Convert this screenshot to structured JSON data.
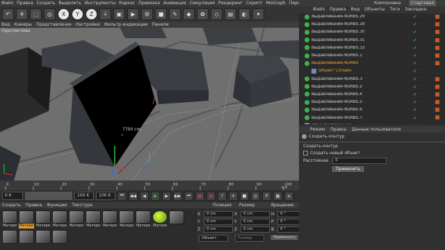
{
  "menubar": [
    "Файл",
    "Правка",
    "Создать",
    "Выделить",
    "Инструменты",
    "Каркас",
    "Привязка",
    "Анимация",
    "Симуляция",
    "Рендеринг",
    "Скрипт",
    "MoGraph",
    "Персонаж",
    "Плагины",
    "Окно",
    "Справка"
  ],
  "toolbar_icons": [
    {
      "name": "undo-icon",
      "glyph": "↶"
    },
    {
      "name": "move-icon",
      "glyph": "✛"
    },
    {
      "name": "select-icon",
      "glyph": "⬚"
    },
    {
      "name": "rotate-icon",
      "glyph": "◎"
    },
    {
      "name": "x-axis-icon",
      "glyph": "X"
    },
    {
      "name": "y-axis-icon",
      "glyph": "Y"
    },
    {
      "name": "z-axis-icon",
      "glyph": "Z"
    },
    {
      "name": "coordinate-icon",
      "glyph": "⤓"
    },
    {
      "name": "render-region-icon",
      "glyph": "▣"
    },
    {
      "name": "render-view-icon",
      "glyph": "▶"
    },
    {
      "name": "render-settings-icon",
      "glyph": "⚙"
    },
    {
      "name": "cube-icon",
      "glyph": "■"
    },
    {
      "name": "pen-icon",
      "glyph": "✎"
    },
    {
      "name": "subdivision-icon",
      "glyph": "◆"
    },
    {
      "name": "array-icon",
      "glyph": "✿"
    },
    {
      "name": "deformer-icon",
      "glyph": "◇"
    },
    {
      "name": "scene-icon",
      "glyph": "▤"
    },
    {
      "name": "camera-icon",
      "glyph": "◐"
    },
    {
      "name": "light-icon",
      "glyph": "✦"
    }
  ],
  "viewport_menu": [
    "Вид",
    "Камеры",
    "Представление",
    "Настройки",
    "Фильтр индикации",
    "Панели"
  ],
  "viewport_label": "Перспектива",
  "viewport_measure": "7700 cm",
  "timeline": {
    "ticks": [
      "0",
      "10",
      "20",
      "30",
      "40",
      "50",
      "60",
      "70",
      "80",
      "90",
      "100"
    ],
    "current_frame": "0 F",
    "start": "0 K",
    "end_a": "100 K",
    "end_b": "100 K",
    "frame_field": "0 K"
  },
  "material_menu": [
    "Создать",
    "Правка",
    "Функции",
    "Текстура"
  ],
  "materials": [
    {
      "label": "Матери",
      "sel": false
    },
    {
      "label": "Матери",
      "sel": true
    },
    {
      "label": "Матери",
      "sel": false
    },
    {
      "label": "Матери",
      "sel": false
    },
    {
      "label": "Матери",
      "sel": false
    },
    {
      "label": "Матери",
      "sel": false
    },
    {
      "label": "Матери",
      "sel": false
    },
    {
      "label": "Матери",
      "sel": false
    },
    {
      "label": "Матери",
      "sel": false
    },
    {
      "label": "Матери",
      "sel": false
    },
    {
      "label": "",
      "sel": false
    },
    {
      "label": "",
      "sel": false
    },
    {
      "label": "",
      "sel": false
    },
    {
      "label": "",
      "sel": false
    },
    {
      "label": "",
      "sel": false
    }
  ],
  "coords": {
    "headers": [
      "Позиция",
      "Размер",
      "Вращение"
    ],
    "rows": [
      {
        "axis": "X",
        "pos": "0 cm",
        "size": "0 cm",
        "rot_label": "H",
        "rot": "0 °"
      },
      {
        "axis": "Y",
        "pos": "0 cm",
        "size": "0 cm",
        "rot_label": "P",
        "rot": "0 °"
      },
      {
        "axis": "Z",
        "pos": "0 cm",
        "size": "0 cm",
        "rot_label": "B",
        "rot": "0 °"
      }
    ],
    "mode": "Объект",
    "size_mode": "Размер",
    "apply": "Применить"
  },
  "right_tabs": [
    "Компоновка",
    "Стартовая"
  ],
  "object_menu": [
    "Файл",
    "Правка",
    "Вид",
    "Объекты",
    "Теги",
    "Закладка"
  ],
  "objects": [
    {
      "name": "Выдавливание-NURBS.29",
      "type": "nurbs",
      "hl": false
    },
    {
      "name": "Выдавливание-NURBS.28",
      "type": "nurbs",
      "hl": false
    },
    {
      "name": "Выдавливание-NURBS.30",
      "type": "nurbs",
      "hl": false
    },
    {
      "name": "Выдавливание-NURBS.31",
      "type": "nurbs",
      "hl": false
    },
    {
      "name": "Выдавливание-NURBS.32",
      "type": "nurbs",
      "hl": false
    },
    {
      "name": "Выдавливание-NURBS.1",
      "type": "nurbs",
      "hl": false
    },
    {
      "name": "Выдавливание-NURBS",
      "type": "nurbs",
      "hl": true
    },
    {
      "name": "Объект Сплайн",
      "type": "spline",
      "hl": true
    },
    {
      "name": "Выдавливание-NURBS.3",
      "type": "nurbs",
      "hl": false
    },
    {
      "name": "Выдавливание-NURBS.2",
      "type": "nurbs",
      "hl": false
    },
    {
      "name": "Выдавливание-NURBS.4",
      "type": "nurbs",
      "hl": false
    },
    {
      "name": "Выдавливание-NURBS.5",
      "type": "nurbs",
      "hl": false
    },
    {
      "name": "Выдавливание-NURBS.6",
      "type": "nurbs",
      "hl": false
    },
    {
      "name": "Выдавливание-NURBS.7",
      "type": "nurbs",
      "hl": false
    },
    {
      "name": "Объект Сплайн.13",
      "type": "spline",
      "hl": false
    },
    {
      "name": "Объект Сплайн.12",
      "type": "spline",
      "hl": false
    },
    {
      "name": "Объект Сплайн.11",
      "type": "spline",
      "hl": false
    }
  ],
  "attr_menu": [
    "Режим",
    "Правка",
    "Данные пользователя"
  ],
  "attr_header": "Создать контур",
  "attr_title": "Создать контур",
  "attr_checkbox": "Создать новый объект",
  "attr_distance_label": "Расстояние",
  "attr_distance_value": "0",
  "attr_apply": "Применить"
}
